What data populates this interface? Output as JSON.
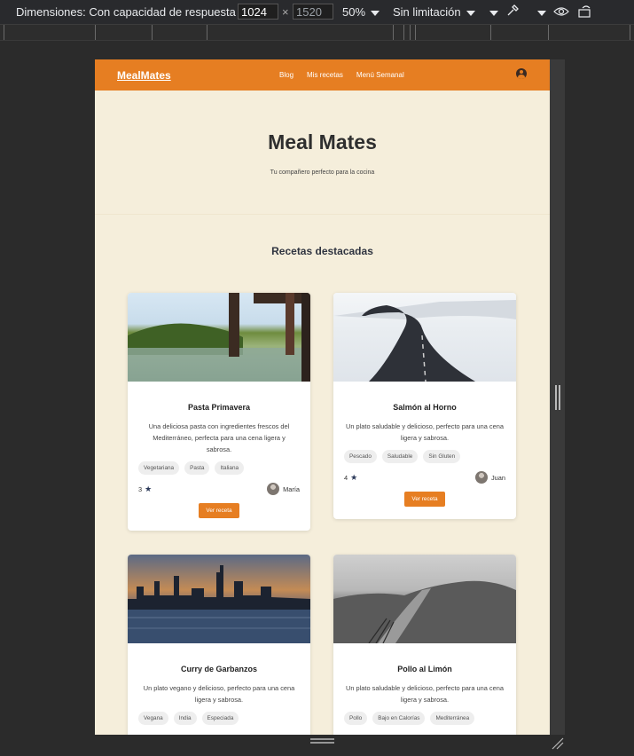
{
  "devtools": {
    "dimensions_label": "Dimensiones: Con capacidad de respuesta",
    "width": "1024",
    "height": "1520",
    "zoom": "50%",
    "throttle": "Sin limitación"
  },
  "site": {
    "logo": "MealMates",
    "nav": [
      "Blog",
      "Mis recetas",
      "Menú Semanal"
    ],
    "hero_title": "Meal Mates",
    "hero_subtitle": "Tu compañero perfecto para la cocina",
    "section_title": "Recetas destacadas"
  },
  "recipes": [
    {
      "title": "Pasta Primavera",
      "description": "Una deliciosa pasta con ingredientes frescos del Mediterráneo, perfecta para una cena ligera y sabrosa.",
      "tags": [
        "Vegetariana",
        "Pasta",
        "Italiana"
      ],
      "rating": "3",
      "author": "María",
      "button": "Ver receta"
    },
    {
      "title": "Salmón al Horno",
      "description": "Un plato saludable y delicioso, perfecto para una cena ligera y sabrosa.",
      "tags": [
        "Pescado",
        "Saludable",
        "Sin Gluten"
      ],
      "rating": "4",
      "author": "Juan",
      "button": "Ver receta"
    },
    {
      "title": "Curry de Garbanzos",
      "description": "Un plato vegano y delicioso, perfecto para una cena ligera y sabrosa.",
      "tags": [
        "Vegana",
        "India",
        "Especiada"
      ]
    },
    {
      "title": "Pollo al Limón",
      "description": "Un plato saludable y delicioso, perfecto para una cena ligera y sabrosa.",
      "tags": [
        "Pollo",
        "Bajo en Calorías",
        "Mediterránea"
      ]
    }
  ]
}
